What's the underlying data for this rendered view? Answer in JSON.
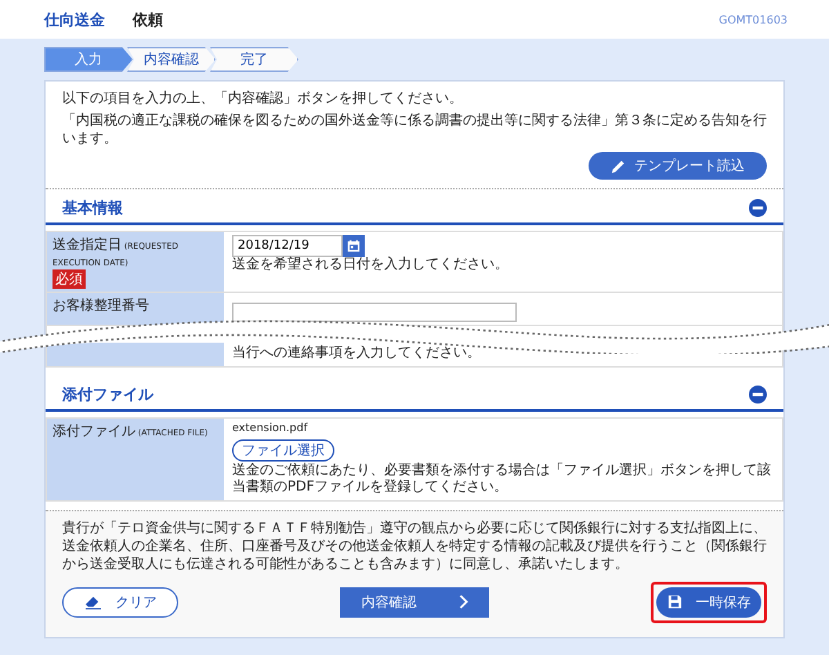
{
  "header": {
    "title": "仕向送金",
    "subtitle": "依頼",
    "screen_id": "GOMT01603"
  },
  "steps": [
    {
      "label": "入力",
      "selected": true
    },
    {
      "label": "内容確認",
      "selected": false
    },
    {
      "label": "完了",
      "selected": false
    }
  ],
  "intro": [
    "以下の項目を入力の上、「内容確認」ボタンを押してください。",
    "「内国税の適正な課税の確保を図るための国外送金等に係る調書の提出等に関する法律」第３条に定める告知を行います。"
  ],
  "template_button": "テンプレート読込",
  "sections": [
    {
      "title": "基本情報",
      "expanded": true,
      "torn": true,
      "rows": [
        {
          "kind": "date",
          "label": "送金指定日",
          "label_en": "(REQUESTED EXECUTION DATE)",
          "required": "必須",
          "value": "2018/12/19",
          "hint": "送金を希望される日付を入力してください。"
        },
        {
          "kind": "text",
          "label": "お客様整理番号"
        },
        {
          "kind": "note",
          "hint": "当行への連絡事項を入力してください。"
        }
      ]
    },
    {
      "title": "添付ファイル",
      "expanded": true,
      "torn": false,
      "rows": [
        {
          "kind": "file",
          "label": "添付ファイル",
          "label_en": "(ATTACHED FILE)",
          "filename": "extension.pdf",
          "button": "ファイル選択",
          "hint": "送金のご依頼にあたり、必要書類を添付する場合は「ファイル選択」ボタンを押して該当書類のPDFファイルを登録してください。"
        }
      ]
    }
  ],
  "agreement": "貴行が「テロ資金供与に関するＦＡＴＦ特別勧告」遵守の観点から必要に応じて関係銀行に対する支払指図上に、送金依頼人の企業名、住所、口座番号及びその他送金依頼人を特定する情報の記載及び提供を行うこと（関係銀行から送金受取人にも伝達される可能性があることも含みます）に同意し、承諾いたします。",
  "buttons": [
    {
      "kind": "clear",
      "label": "クリア",
      "highlighted": false
    },
    {
      "kind": "confirm",
      "label": "内容確認",
      "highlighted": false
    },
    {
      "kind": "save",
      "label": "一時保存",
      "highlighted": true
    }
  ]
}
